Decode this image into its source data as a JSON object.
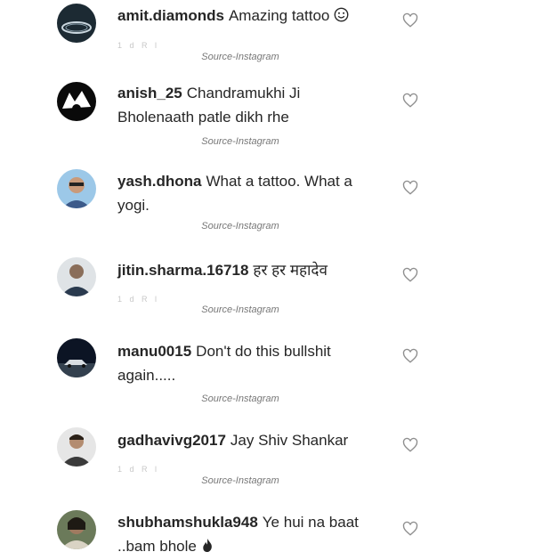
{
  "source_caption": "Source-Instagram",
  "comments": [
    {
      "username": "amit.diamonds",
      "text": "Amazing tattoo",
      "emoji": "smiley-face-icon",
      "meta": "1 d   R  l"
    },
    {
      "username": "anish_25",
      "text": "Chandramukhi Ji Bholenaath patle dikh rhe",
      "meta": ""
    },
    {
      "username": "yash.dhona",
      "text": "What a tattoo. What a yogi.",
      "meta": ""
    },
    {
      "username": "jitin.sharma.16718",
      "text": "हर हर महादेव",
      "meta": "1 d   R  l"
    },
    {
      "username": "manu0015",
      "text": "Don't do this bullshit again.....",
      "meta": ""
    },
    {
      "username": "gadhavivg2017",
      "text": "Jay Shiv Shankar",
      "meta": "1 d   R  l"
    },
    {
      "username": "shubhamshukla948",
      "text": "Ye hui na baat ..bam bhole",
      "emoji": "fire-icon",
      "meta": ""
    }
  ],
  "colors": {
    "text": "#262626",
    "heart": "#8e8e8e",
    "caption": "#777777"
  }
}
